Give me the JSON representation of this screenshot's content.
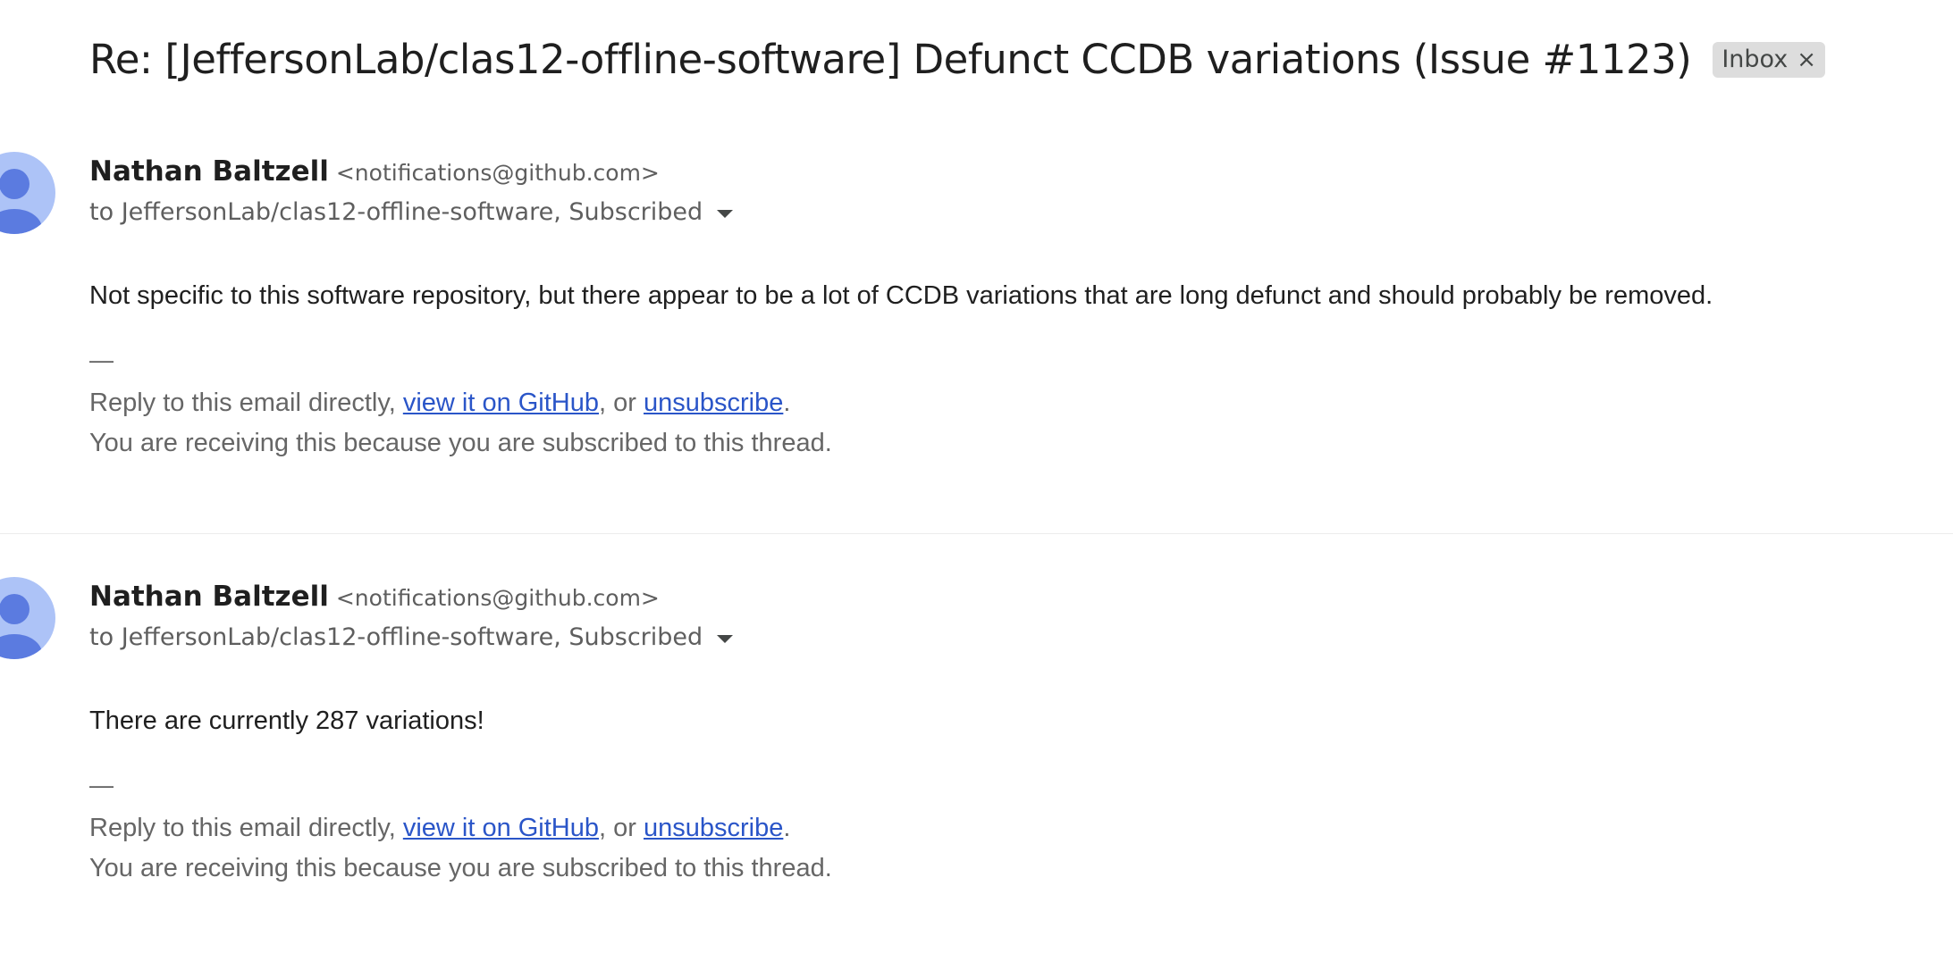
{
  "thread": {
    "subject": "Re: [JeffersonLab/clas12-offline-software] Defunct CCDB variations (Issue #1123)",
    "label": "Inbox",
    "label_close_glyph": "×"
  },
  "messages": [
    {
      "sender_name": "Nathan Baltzell",
      "sender_email": "<notifications@github.com>",
      "recipients": "to JeffersonLab/clas12-offline-software, Subscribed",
      "body": "Not specific to this software repository, but there appear to be a lot of CCDB variations that are long defunct and should probably be removed.",
      "signature_dash": "—",
      "footer_prefix": "Reply to this email directly, ",
      "footer_link_github": "view it on GitHub",
      "footer_middle": ", or ",
      "footer_link_unsubscribe": "unsubscribe",
      "footer_suffix": ".",
      "footer_line2": "You are receiving this because you are subscribed to this thread."
    },
    {
      "sender_name": "Nathan Baltzell",
      "sender_email": "<notifications@github.com>",
      "recipients": "to JeffersonLab/clas12-offline-software, Subscribed",
      "body": "There are currently 287 variations!",
      "signature_dash": "—",
      "footer_prefix": "Reply to this email directly, ",
      "footer_link_github": "view it on GitHub",
      "footer_middle": ", or ",
      "footer_link_unsubscribe": "unsubscribe",
      "footer_suffix": ".",
      "footer_line2": "You are receiving this because you are subscribed to this thread."
    }
  ],
  "colors": {
    "link": "#2a55c8",
    "avatar_bg": "#adc3f7",
    "avatar_fg": "#5b7be0",
    "label_chip_bg": "#dddddd"
  },
  "icons": {
    "avatar": "default-person-icon",
    "recipients_toggle": "caret-down-icon",
    "label_remove": "close-icon"
  }
}
